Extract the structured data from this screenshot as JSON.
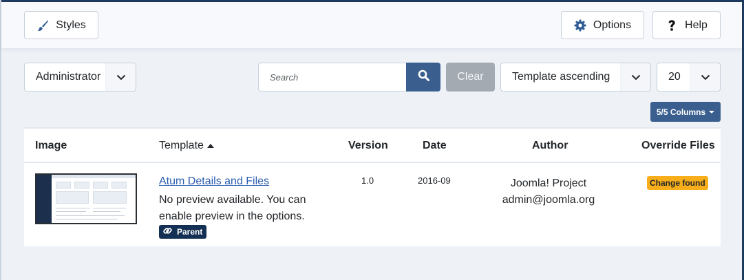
{
  "toolbar": {
    "styles_label": "Styles",
    "options_label": "Options",
    "help_label": "Help"
  },
  "filters": {
    "client_value": "Administrator",
    "search_placeholder": "Search",
    "search_value": "",
    "clear_label": "Clear",
    "ordering_value": "Template ascending",
    "limit_value": "20",
    "columns_label": "5/5 Columns"
  },
  "table": {
    "headers": {
      "image": "Image",
      "template": "Template",
      "version": "Version",
      "date": "Date",
      "author": "Author",
      "override": "Override Files"
    },
    "rows": [
      {
        "template_link": "Atum Details and Files",
        "description": "No preview available. You can enable preview in the options.",
        "parent_badge": "Parent",
        "version": "1.0",
        "date": "2016-09",
        "author_name": "Joomla! Project",
        "author_email": "admin@joomla.org",
        "override_status": "Change found"
      }
    ]
  },
  "colors": {
    "primary": "#3a5f8f",
    "link": "#2a5db0",
    "badge_dark": "#132f53",
    "badge_warning": "#f7ae1a",
    "clear_button": "#a3aab2",
    "background": "#eef2f7"
  },
  "icons": {
    "styles": "paint-brush-icon",
    "options": "gear-icon",
    "help": "question-icon",
    "search": "search-icon",
    "dropdown": "chevron-down-icon",
    "parent": "link-icon",
    "sort": "sort-ascending-icon"
  }
}
